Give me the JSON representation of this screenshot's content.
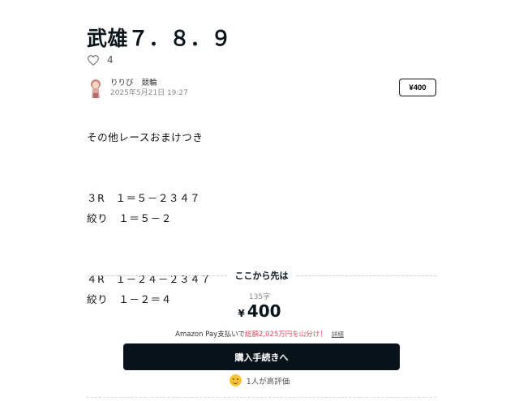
{
  "article": {
    "title": "武雄７．８．９",
    "like_count": "4",
    "author": {
      "name": "りりび",
      "category": "競輪",
      "date": "2025年5月21日 19:27"
    },
    "price_button": "¥400",
    "lines": [
      "その他レースおまけつき",
      "",
      "",
      "３R　１＝５－２３４７",
      "絞り　１＝５－２",
      "",
      "",
      "４R　１－２４－２３４７",
      "絞り　１－２＝４"
    ]
  },
  "paywall": {
    "divider_label": "ここから先は",
    "char_count": "135字",
    "currency": "¥",
    "amount": "400",
    "pay_text_prefix": "Amazon Pay支払いで",
    "pay_text_highlight": "総額2,025万円を山分け！",
    "pay_detail_link": "詳細",
    "buy_button": "購入手続きへ",
    "rating_text": "1人が高評価"
  },
  "colors": {
    "primary": "#08131a",
    "highlight": "#e2475f"
  },
  "icons": {
    "like": "heart-outline-icon",
    "rating": "smile-icon"
  }
}
